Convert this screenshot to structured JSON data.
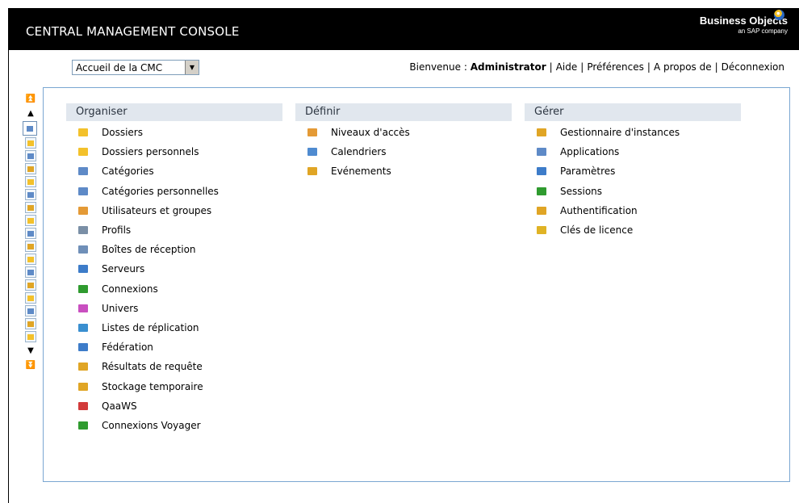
{
  "header": {
    "title": "CENTRAL MANAGEMENT CONSOLE",
    "brand": "Business Objects",
    "brand_sub": "an SAP company"
  },
  "home_select": {
    "value": "Accueil de la CMC"
  },
  "user_nav": {
    "welcome": "Bienvenue :",
    "user": "Administrator",
    "links": [
      "Aide",
      "Préférences",
      "A propos de",
      "Déconnexion"
    ]
  },
  "columns": [
    {
      "title": "Organiser",
      "items": [
        {
          "label": "Dossiers",
          "icon": "folder-icon",
          "color": "#f3c12b"
        },
        {
          "label": "Dossiers personnels",
          "icon": "personal-folder-icon",
          "color": "#f3c12b"
        },
        {
          "label": "Catégories",
          "icon": "category-icon",
          "color": "#5e8ac7"
        },
        {
          "label": "Catégories personnelles",
          "icon": "personal-category-icon",
          "color": "#5e8ac7"
        },
        {
          "label": "Utilisateurs et groupes",
          "icon": "users-groups-icon",
          "color": "#e49a36"
        },
        {
          "label": "Profils",
          "icon": "profiles-icon",
          "color": "#7a8fa6"
        },
        {
          "label": "Boîtes de réception",
          "icon": "inbox-icon",
          "color": "#6f8fb8"
        },
        {
          "label": "Serveurs",
          "icon": "servers-icon",
          "color": "#3d7cc9"
        },
        {
          "label": "Connexions",
          "icon": "connections-icon",
          "color": "#2f9b2f"
        },
        {
          "label": "Univers",
          "icon": "universe-icon",
          "color": "#c94fc0"
        },
        {
          "label": "Listes de réplication",
          "icon": "replication-icon",
          "color": "#3a8fd0"
        },
        {
          "label": "Fédération",
          "icon": "federation-icon",
          "color": "#3d7cc9"
        },
        {
          "label": "Résultats de requête",
          "icon": "query-results-icon",
          "color": "#e0a525"
        },
        {
          "label": "Stockage temporaire",
          "icon": "temp-storage-icon",
          "color": "#e0a525"
        },
        {
          "label": "QaaWS",
          "icon": "qaaws-icon",
          "color": "#d23a3a"
        },
        {
          "label": "Connexions Voyager",
          "icon": "voyager-icon",
          "color": "#2f9b2f"
        }
      ]
    },
    {
      "title": "Définir",
      "items": [
        {
          "label": "Niveaux d'accès",
          "icon": "access-levels-icon",
          "color": "#e49a36"
        },
        {
          "label": "Calendriers",
          "icon": "calendar-icon",
          "color": "#4f8bd0"
        },
        {
          "label": "Evénements",
          "icon": "events-icon",
          "color": "#e0a525"
        }
      ]
    },
    {
      "title": "Gérer",
      "items": [
        {
          "label": "Gestionnaire d'instances",
          "icon": "instance-manager-icon",
          "color": "#e0a525"
        },
        {
          "label": "Applications",
          "icon": "applications-icon",
          "color": "#5e8ac7"
        },
        {
          "label": "Paramètres",
          "icon": "settings-icon",
          "color": "#3d7cc9"
        },
        {
          "label": "Sessions",
          "icon": "sessions-icon",
          "color": "#2f9b2f"
        },
        {
          "label": "Authentification",
          "icon": "authentication-icon",
          "color": "#e0a525"
        },
        {
          "label": "Clés de licence",
          "icon": "license-key-icon",
          "color": "#e0b325"
        }
      ]
    }
  ],
  "toolbar": {
    "icons": [
      "home-icon",
      "folder-icon",
      "personal-folder-icon",
      "category-icon",
      "personal-category-icon",
      "users-groups-icon",
      "profiles-icon",
      "inbox-icon",
      "servers-icon",
      "connections-icon",
      "universe-icon",
      "replication-icon",
      "federation-icon",
      "query-results-icon",
      "temp-storage-icon",
      "access-levels-icon",
      "calendar-icon"
    ]
  }
}
